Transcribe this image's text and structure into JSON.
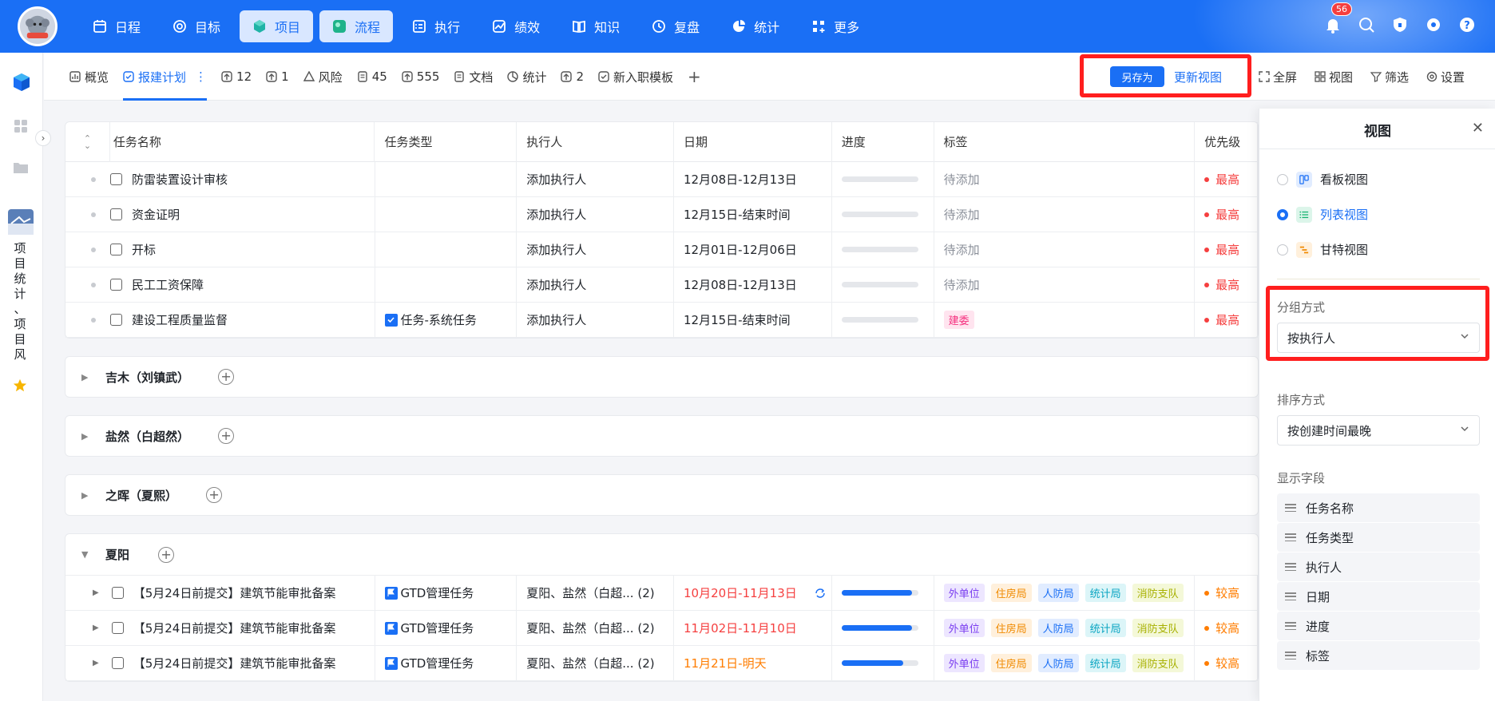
{
  "topnav": {
    "items": [
      {
        "label": "日程",
        "icon": "calendar-icon"
      },
      {
        "label": "目标",
        "icon": "target-icon"
      },
      {
        "label": "项目",
        "icon": "cube-icon",
        "active": true
      },
      {
        "label": "流程",
        "icon": "flow-icon",
        "active": true
      },
      {
        "label": "执行",
        "icon": "checklist-icon"
      },
      {
        "label": "绩效",
        "icon": "performance-icon"
      },
      {
        "label": "知识",
        "icon": "book-icon"
      },
      {
        "label": "复盘",
        "icon": "review-icon"
      },
      {
        "label": "统计",
        "icon": "pie-chart-icon"
      },
      {
        "label": "更多",
        "icon": "grid-plus-icon"
      }
    ],
    "notification_count": "56"
  },
  "leftrail": {
    "vertical_text": [
      "项",
      "目",
      "统",
      "计",
      "、",
      "项",
      "目",
      "风"
    ]
  },
  "tabs": [
    {
      "label": "概览",
      "icon": "chart-icon"
    },
    {
      "label": "报建计划",
      "icon": "check-circle-icon",
      "active": true
    },
    {
      "label": "12",
      "icon": "upload-icon"
    },
    {
      "label": "1",
      "icon": "upload-icon"
    },
    {
      "label": "风险",
      "icon": "warning-icon"
    },
    {
      "label": "45",
      "icon": "document-icon"
    },
    {
      "label": "555",
      "icon": "upload-icon"
    },
    {
      "label": "文档",
      "icon": "file-icon"
    },
    {
      "label": "统计",
      "icon": "pie-chart-icon"
    },
    {
      "label": "2",
      "icon": "upload-icon"
    },
    {
      "label": "新入职模板",
      "icon": "check-circle-icon"
    }
  ],
  "toolbar": {
    "save_as": "另存为",
    "update_view": "更新视图",
    "fullscreen": "全屏",
    "view": "视图",
    "filter": "筛选",
    "settings": "设置"
  },
  "table": {
    "headers": [
      "任务名称",
      "任务类型",
      "执行人",
      "日期",
      "进度",
      "标签",
      "优先级"
    ],
    "rows_top": [
      {
        "name": "防雷装置设计审核",
        "type": "",
        "exec": "添加执行人",
        "date": "12月08日-12月13日",
        "progress": 0,
        "tag": "待添加",
        "priority": "最高"
      },
      {
        "name": "资金证明",
        "type": "",
        "exec": "添加执行人",
        "date": "12月15日-结束时间",
        "progress": 0,
        "tag": "待添加",
        "priority": "最高"
      },
      {
        "name": "开标",
        "type": "",
        "exec": "添加执行人",
        "date": "12月01日-12月06日",
        "progress": 0,
        "tag": "待添加",
        "priority": "最高"
      },
      {
        "name": "民工工资保障",
        "type": "",
        "exec": "添加执行人",
        "date": "12月08日-12月13日",
        "progress": 0,
        "tag": "待添加",
        "priority": "最高"
      },
      {
        "name": "建设工程质量监督",
        "type": "任务-系统任务",
        "exec": "添加执行人",
        "date": "12月15日-结束时间",
        "progress": 0,
        "tag_badge": "建委",
        "priority": "最高"
      }
    ],
    "groups": [
      "吉木（刘镇武）",
      "盐然（白超然）",
      "之晖（夏熙）",
      "夏阳"
    ],
    "rows_bottom": [
      {
        "name": "【5月24日前提交】建筑节能审批备案",
        "type": "GTD管理任务",
        "exec": "夏阳、盐然（白超... (2)",
        "date": "10月20日-11月13日",
        "progress": 0.92,
        "priority": "较高"
      },
      {
        "name": "【5月24日前提交】建筑节能审批备案",
        "type": "GTD管理任务",
        "exec": "夏阳、盐然（白超... (2)",
        "date": "11月02日-11月10日",
        "progress": 0.92,
        "priority": "较高"
      },
      {
        "name": "【5月24日前提交】建筑节能审批备案",
        "type": "GTD管理任务",
        "exec": "夏阳、盐然（白超... (2)",
        "date": "11月21日-明天",
        "progress": 0.8,
        "priority": "较高"
      }
    ],
    "bottom_tags": [
      "外单位",
      "住房局",
      "人防局",
      "统计局",
      "消防支队"
    ]
  },
  "panel": {
    "title": "视图",
    "views": [
      "看板视图",
      "列表视图",
      "甘特视图"
    ],
    "group_label": "分组方式",
    "group_value": "按执行人",
    "sort_label": "排序方式",
    "sort_value": "按创建时间最晚",
    "fields_label": "显示字段",
    "fields": [
      "任务名称",
      "任务类型",
      "执行人",
      "日期",
      "进度",
      "标签"
    ]
  },
  "colors": {
    "primary": "#1a6ff5",
    "danger": "#f53f3f",
    "warning": "#ff7d00"
  }
}
